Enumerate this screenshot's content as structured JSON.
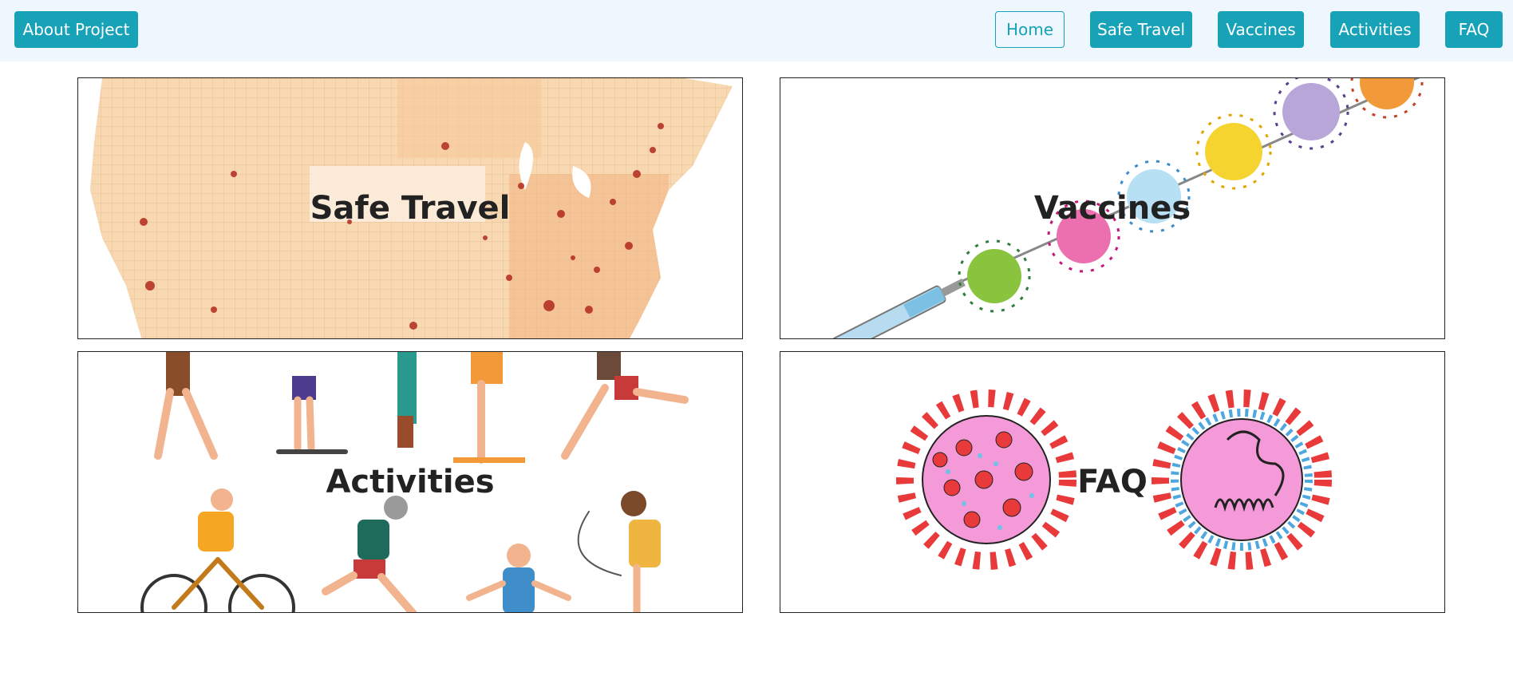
{
  "navbar": {
    "about_label": "About Project",
    "home_label": "Home",
    "safe_travel_label": "Safe Travel",
    "vaccines_label": "Vaccines",
    "activities_label": "Activities",
    "faq_label": "FAQ"
  },
  "cards": {
    "safe_travel": {
      "title": "Safe Travel",
      "image": "us-county-map-image"
    },
    "vaccines": {
      "title": "Vaccines",
      "image": "syringe-with-viruses-image"
    },
    "activities": {
      "title": "Activities",
      "image": "people-exercising-image"
    },
    "faq": {
      "title": "FAQ",
      "image": "coronavirus-illustration-image"
    }
  },
  "colors": {
    "accent": "#17a2b8",
    "navbar_bg": "#eef7fd",
    "text": "#222222"
  }
}
